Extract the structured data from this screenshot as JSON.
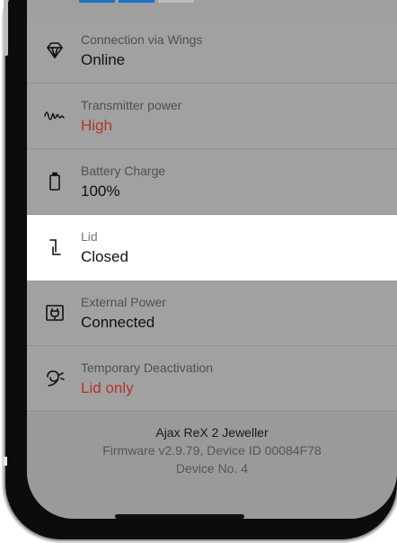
{
  "colors": {
    "bar_blue": "#1a73c9",
    "bar_gray": "#bdbdbd",
    "warn": "#b3362c"
  },
  "rows": [
    {
      "icon": "wings-diamond-icon",
      "label": "Connection via Wings",
      "value": "Online"
    },
    {
      "icon": "signal-wave-icon",
      "label": "Transmitter power",
      "value": "High"
    },
    {
      "icon": "battery-icon",
      "label": "Battery Charge",
      "value": "100%"
    },
    {
      "icon": "lid-icon",
      "label": "Lid",
      "value": "Closed"
    },
    {
      "icon": "plug-icon",
      "label": "External Power",
      "value": "Connected"
    },
    {
      "icon": "deactivation-icon",
      "label": "Temporary Deactivation",
      "value": "Lid only"
    }
  ],
  "footer": {
    "device_name": "Ajax ReX 2 Jeweller",
    "firmware_line": "Firmware v2.9.79, Device ID 00084F78",
    "device_number": "Device No. 4"
  }
}
